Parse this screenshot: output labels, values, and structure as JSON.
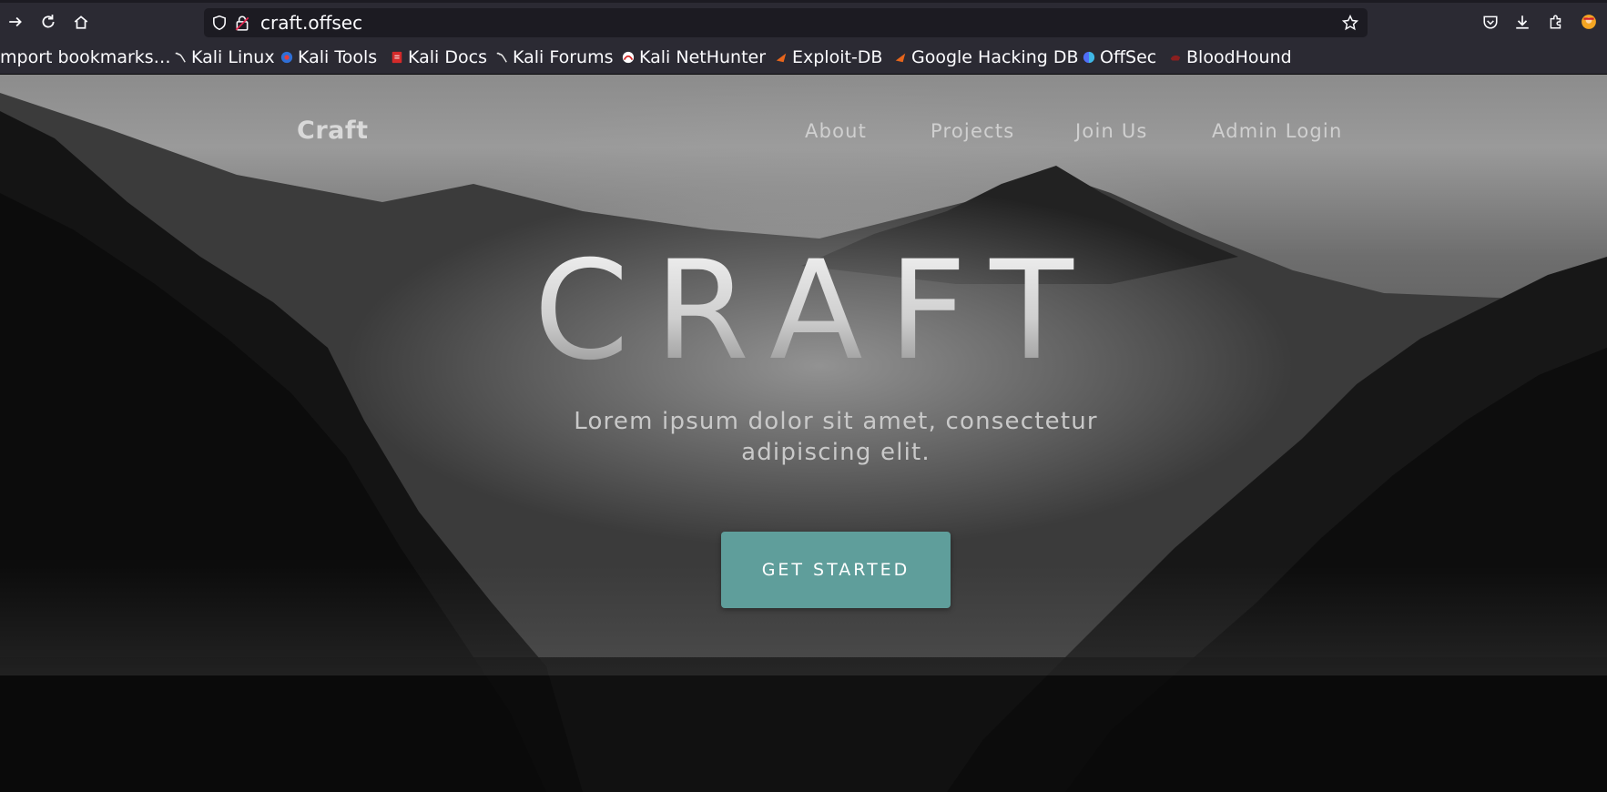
{
  "browser": {
    "url": "craft.offsec",
    "bookmarks": [
      {
        "label": "mport bookmarks…",
        "icon": "none"
      },
      {
        "label": "Kali Linux",
        "icon": "kali-dragon-icon"
      },
      {
        "label": "Kali Tools",
        "icon": "kali-tools-icon"
      },
      {
        "label": "Kali Docs",
        "icon": "kali-docs-icon"
      },
      {
        "label": "Kali Forums",
        "icon": "kali-dragon-icon"
      },
      {
        "label": "Kali NetHunter",
        "icon": "nethunter-icon"
      },
      {
        "label": "Exploit-DB",
        "icon": "exploit-db-icon"
      },
      {
        "label": "Google Hacking DB",
        "icon": "exploit-db-icon"
      },
      {
        "label": "OffSec",
        "icon": "offsec-icon"
      },
      {
        "label": "BloodHound",
        "icon": "bloodhound-icon"
      }
    ]
  },
  "site": {
    "brand": "Craft",
    "nav": [
      "About",
      "Projects",
      "Join Us",
      "Admin Login"
    ],
    "hero_title": "CRAFT",
    "hero_subtitle": "Lorem ipsum dolor sit amet, consectetur adipiscing elit.",
    "cta_label": "GET STARTED",
    "accent_color": "#5f9e9b"
  }
}
